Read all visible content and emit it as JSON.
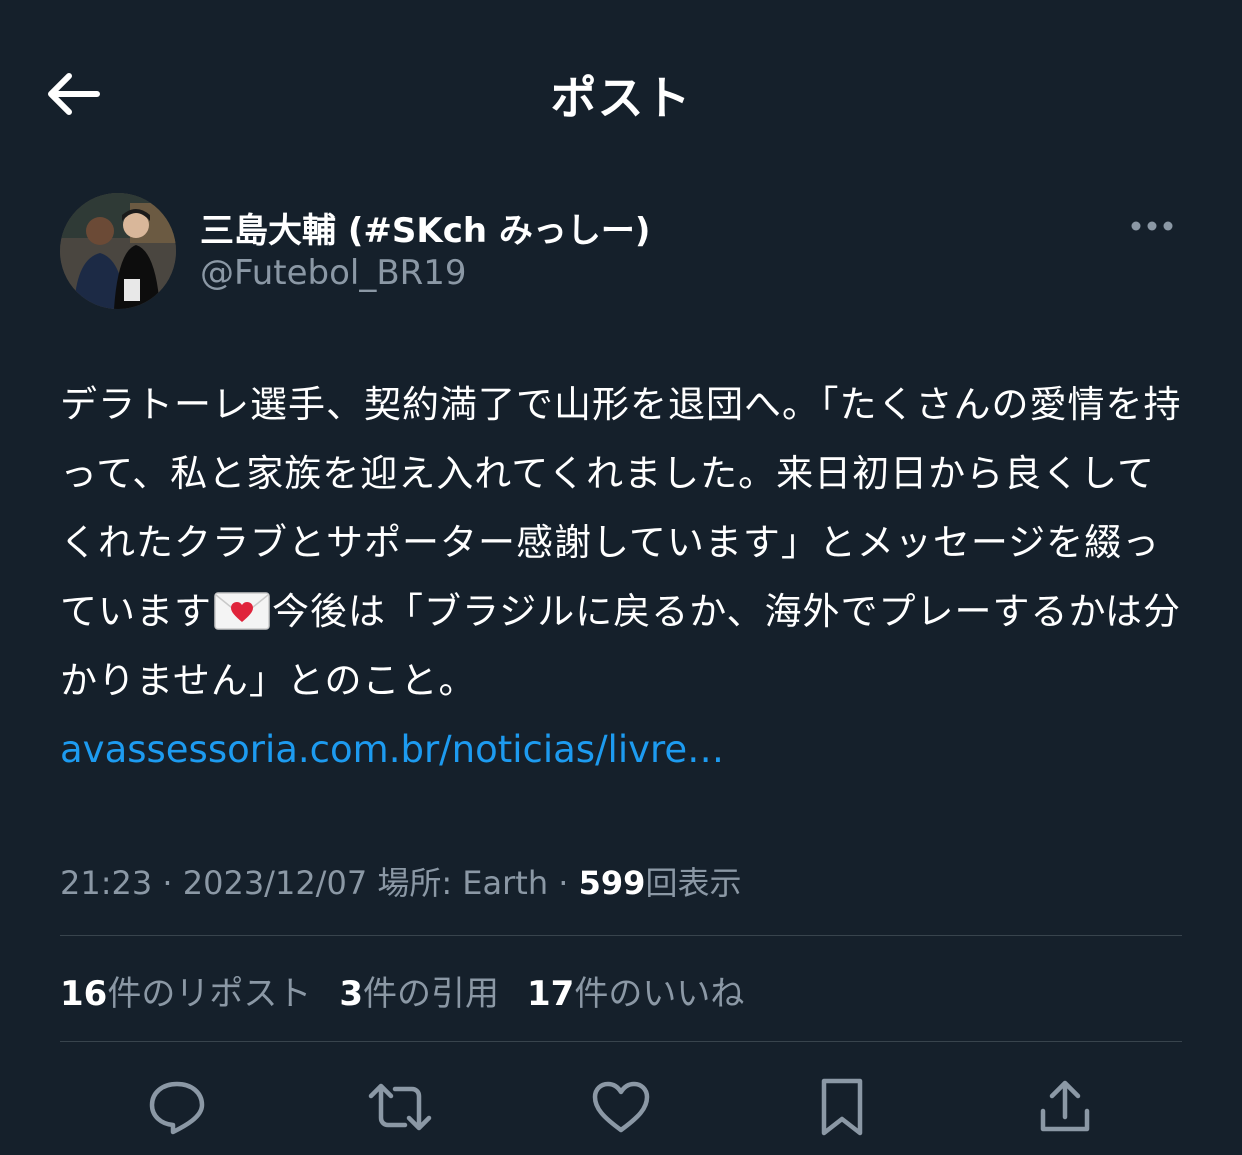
{
  "header": {
    "title": "ポスト",
    "back_icon": "arrow-left-icon"
  },
  "author": {
    "display_name": "三島大輔 (#SKch みっしー)",
    "handle": "@Futebol_BR19",
    "more_icon": "more-horizontal-icon"
  },
  "tweet": {
    "text_part1": "デラトーレ選手、契約満了で山形を退団へ。「たくさんの愛情を持って、私と家族を迎え入れてくれました。来日初日から良くしてくれたクラブとサポーター感謝しています」とメッセージを綴っています",
    "emoji": "love-letter-emoji",
    "text_part2": "今後は「ブラジルに戻るか、海外でプレーするかは分かりません」とのこと。",
    "link": "avassessoria.com.br/noticias/livre…"
  },
  "meta": {
    "time": "21:23",
    "date": "2023/12/07",
    "location_label": "場所: Earth",
    "separator": "·",
    "views_count": "599",
    "views_label": "回表示"
  },
  "stats": {
    "reposts_count": "16",
    "reposts_label": "件のリポスト",
    "quotes_count": "3",
    "quotes_label": "件の引用",
    "likes_count": "17",
    "likes_label": "件のいいね"
  },
  "actions": {
    "reply_icon": "reply-icon",
    "repost_icon": "repost-icon",
    "like_icon": "heart-icon",
    "bookmark_icon": "bookmark-icon",
    "share_icon": "share-icon"
  },
  "colors": {
    "background": "#15202b",
    "text": "#ffffff",
    "secondary_text": "#8b98a5",
    "link": "#1d9bf0",
    "divider": "#38444d"
  }
}
